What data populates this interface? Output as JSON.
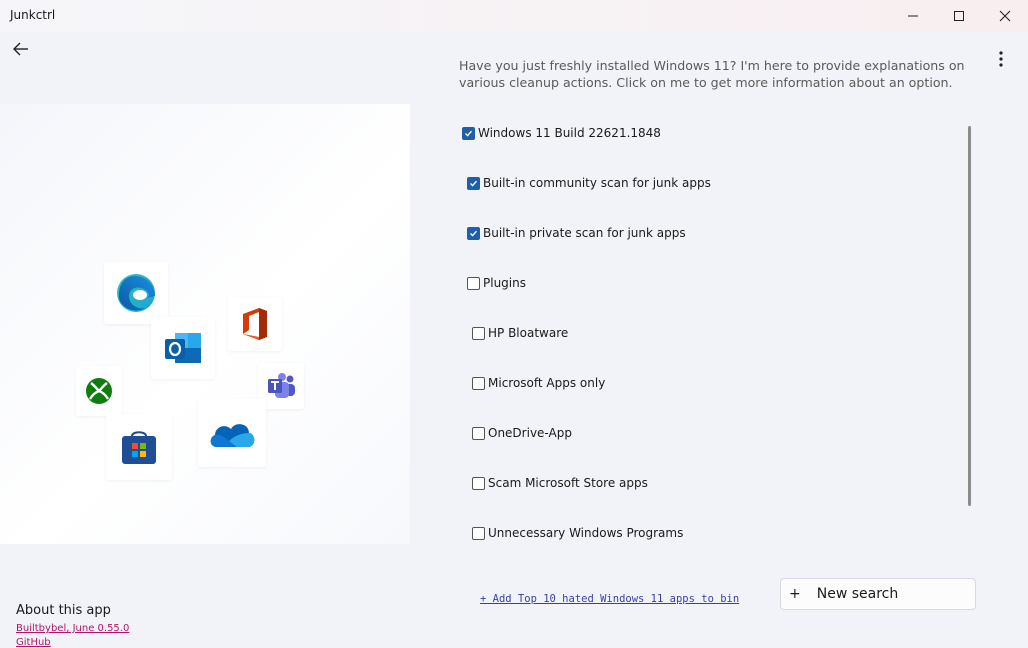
{
  "window": {
    "title": "Junkctrl",
    "minimize_icon": "minimize-icon",
    "maximize_icon": "maximize-icon",
    "close_icon": "close-icon"
  },
  "nav": {
    "back_icon": "arrow-left-icon"
  },
  "hero": {
    "apps": [
      "Microsoft Edge",
      "Microsoft Outlook",
      "Microsoft Office",
      "Microsoft Teams",
      "Xbox",
      "Microsoft Store",
      "OneDrive"
    ]
  },
  "about": {
    "title": "About this app",
    "version_link": "Builtbybel, June 0.55.0",
    "github_link": "GitHub"
  },
  "assistant": {
    "text": "Have you just freshly installed Windows 11? I'm here to provide explanations on various cleanup actions. Click on me to get more information about an option."
  },
  "menu": {
    "more_icon": "more-vertical-icon"
  },
  "options": [
    {
      "label": "Windows 11 Build 22621.1848",
      "checked": true
    },
    {
      "label": "Built-in community scan for junk apps",
      "checked": true
    },
    {
      "label": "Built-in private scan for junk apps",
      "checked": true
    },
    {
      "label": "Plugins",
      "checked": false
    },
    {
      "label": "HP Bloatware",
      "checked": false
    },
    {
      "label": "Microsoft Apps only",
      "checked": false
    },
    {
      "label": "OneDrive-App",
      "checked": false
    },
    {
      "label": "Scam Microsoft Store apps",
      "checked": false
    },
    {
      "label": "Unnecessary Windows Programs",
      "checked": false
    }
  ],
  "footer": {
    "add_link": "+ Add Top 10 hated Windows 11 apps to bin",
    "new_search_icon": "+",
    "new_search_label": "New search"
  },
  "colors": {
    "accent": "#1f5fa8",
    "link": "#b4136a",
    "add_link": "#3a3fa6"
  }
}
